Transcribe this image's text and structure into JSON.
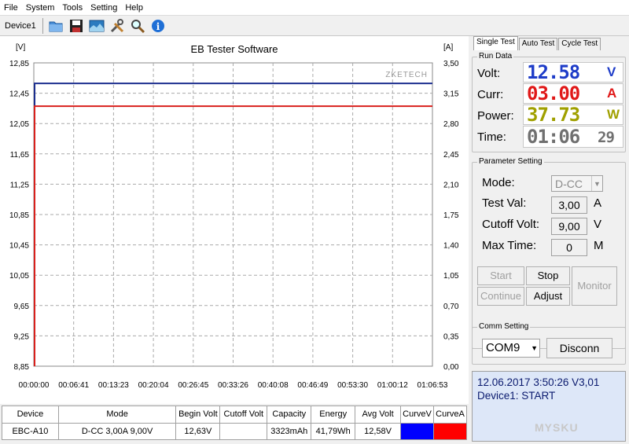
{
  "menu": [
    "File",
    "System",
    "Tools",
    "Setting",
    "Help"
  ],
  "toolbar": {
    "device": "Device1",
    "icons": [
      "open-folder-icon",
      "save-icon",
      "image-icon",
      "tools-icon",
      "search-icon",
      "info-icon"
    ]
  },
  "chart": {
    "title": "EB Tester Software",
    "brand": "ZKETECH",
    "left_unit": "[V]",
    "right_unit": "[A]",
    "left_ticks": [
      "12,85",
      "12,45",
      "12,05",
      "11,65",
      "11,25",
      "10,85",
      "10,45",
      "10,05",
      "9,65",
      "9,25",
      "8,85"
    ],
    "right_ticks": [
      "3,50",
      "3,15",
      "2,80",
      "2,45",
      "2,10",
      "1,75",
      "1,40",
      "1,05",
      "0,70",
      "0,35",
      "0,00"
    ],
    "x_ticks": [
      "00:00:00",
      "00:06:41",
      "00:13:23",
      "00:20:04",
      "00:26:45",
      "00:33:26",
      "00:40:08",
      "00:46:49",
      "00:53:30",
      "01:00:12",
      "01:06:53"
    ]
  },
  "chart_data": {
    "type": "line",
    "title": "EB Tester Software",
    "xlabel": "",
    "ylabel": "[V]",
    "y2label": "[A]",
    "x": [
      "00:00:00",
      "00:06:41",
      "00:13:23",
      "00:20:04",
      "00:26:45",
      "00:33:26",
      "00:40:08",
      "00:46:49",
      "00:53:30",
      "01:00:12",
      "01:06:53"
    ],
    "ylim": [
      8.85,
      12.85
    ],
    "y2lim": [
      0.0,
      3.5
    ],
    "grid": true,
    "series": [
      {
        "axis": "left",
        "color": "#1c2f8f",
        "values": [
          12.58,
          12.58,
          12.58,
          12.58,
          12.58,
          12.58,
          12.58,
          12.58,
          12.58,
          12.58,
          12.58
        ]
      },
      {
        "axis": "right",
        "color": "#d9201c",
        "values": [
          3.0,
          3.0,
          3.0,
          3.0,
          3.0,
          3.0,
          3.0,
          3.0,
          3.0,
          3.0,
          3.0
        ]
      }
    ]
  },
  "table": {
    "headers": [
      "Device",
      "Mode",
      "Begin Volt",
      "Cutoff Volt",
      "Capacity",
      "Energy",
      "Avg Volt",
      "CurveV",
      "CurveA"
    ],
    "row": [
      "EBC-A10",
      "D-CC  3,00A  9,00V",
      "12,63V",
      "",
      "3323mAh",
      "41,79Wh",
      "12,58V"
    ],
    "curve_v_color": "#0000ff",
    "curve_a_color": "#ff0000"
  },
  "tabs": [
    "Single Test",
    "Auto Test",
    "Cycle Test"
  ],
  "run_data": {
    "title": "Run Data",
    "volt_label": "Volt:",
    "volt_value": "12.58",
    "volt_unit": "V",
    "volt_color": "#1e3cc8",
    "curr_label": "Curr:",
    "curr_value": "03.00",
    "curr_unit": "A",
    "curr_color": "#e01818",
    "power_label": "Power:",
    "power_value": "37.73",
    "power_unit": "W",
    "power_color": "#a0a000",
    "time_label": "Time:",
    "time_value": "01:06",
    "time_seconds": "29",
    "time_color": "#707070"
  },
  "params": {
    "title": "Parameter Setting",
    "mode_label": "Mode:",
    "mode_value": "D-CC",
    "testval_label": "Test Val:",
    "testval_value": "3,00",
    "testval_unit": "A",
    "cutoff_label": "Cutoff Volt:",
    "cutoff_value": "9,00",
    "cutoff_unit": "V",
    "maxtime_label": "Max Time:",
    "maxtime_value": "0",
    "maxtime_unit": "M",
    "start": "Start",
    "stop": "Stop",
    "continue": "Continue",
    "adjust": "Adjust",
    "monitor": "Monitor"
  },
  "comm": {
    "title": "Comm Setting",
    "port": "COM9",
    "disconn": "Disconn"
  },
  "status": {
    "line1": "12.06.2017 3:50:26  V3,01",
    "line2": "Device1: START"
  },
  "watermark": "MYSKU"
}
